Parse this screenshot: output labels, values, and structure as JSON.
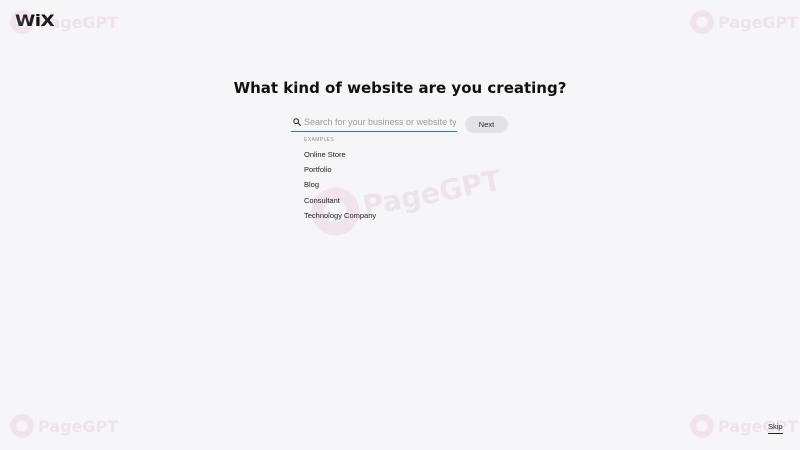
{
  "brand": {
    "logo_text": "WiX"
  },
  "question": {
    "title": "What kind of website are you creating?"
  },
  "search": {
    "placeholder": "Search for your business or website type",
    "value": "",
    "next_label": "Next",
    "icon": "search-icon"
  },
  "examples": {
    "heading": "EXAMPLES",
    "items": [
      {
        "label": "Online Store"
      },
      {
        "label": "Portfolio"
      },
      {
        "label": "Blog"
      },
      {
        "label": "Consultant"
      },
      {
        "label": "Technology Company"
      }
    ]
  },
  "footer": {
    "skip_label": "Skip"
  },
  "watermark": {
    "text": "PageGPT"
  },
  "colors": {
    "background": "#f6f6f8",
    "accent_underline": "#3b6fd8",
    "button_bg": "#e3e3e6"
  }
}
